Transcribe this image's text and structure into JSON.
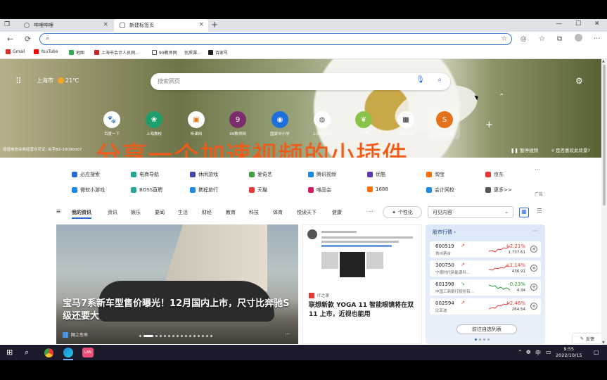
{
  "tabs": [
    {
      "label": "哔哩哔哩",
      "close": "×"
    },
    {
      "label": "新建标签页",
      "close": "×"
    }
  ],
  "tab_new": "+",
  "window_controls": [
    "—",
    "☐",
    "✕"
  ],
  "nav": {
    "back": "←",
    "reload": "⟳"
  },
  "address": {
    "value": "",
    "placeholder": ""
  },
  "bookmarks": [
    {
      "label": "Gmail",
      "color": "#d93025"
    },
    {
      "label": "YouTube",
      "color": "#ff0000"
    },
    {
      "label": "地图",
      "color": "#34a853"
    },
    {
      "label": "上海市会计人员网...",
      "color": "#c62828"
    },
    {
      "label": "99教师网",
      "color": "#555555"
    },
    {
      "label": "优质课...",
      "color": "#444444"
    },
    {
      "label": "百家号",
      "color": "#222222"
    }
  ],
  "hero": {
    "location": "上海市",
    "temperature": "21℃",
    "search_placeholder": "搜索网页",
    "icp": "增值电信业务经营许可证: 合字B2-20090007",
    "pause": "暂停视频",
    "like": "是否喜欢此背景?",
    "overlay_caption": "分享一个加速视频的小插件",
    "quick_links": [
      {
        "label": "百度一下",
        "glyph": "🐾",
        "color": "#2932e1"
      },
      {
        "label": "上海教校",
        "glyph": "❀",
        "color": "#1e9e6a"
      },
      {
        "label": "听课网",
        "glyph": "▣",
        "color": "#e0771b"
      },
      {
        "label": "99教师网",
        "glyph": "9",
        "color": "#7b2d6b"
      },
      {
        "label": "国家中小学",
        "glyph": "◉",
        "color": "#1e6fd9"
      },
      {
        "label": "上海市会计",
        "glyph": "◍",
        "color": "#5a5a5a"
      },
      {
        "label": "https",
        "glyph": "❦",
        "color": "#8bc34a"
      },
      {
        "label": "百度网盘",
        "glyph": "▦",
        "color": "#222222"
      },
      {
        "label": "12门户网",
        "glyph": "S",
        "color": "#e6711b"
      }
    ]
  },
  "links": [
    {
      "label": "必应搜索",
      "color": "#2b6cd1"
    },
    {
      "label": "电商导航",
      "color": "#26a69a"
    },
    {
      "label": "休闲游戏",
      "color": "#3949ab"
    },
    {
      "label": "爱奇艺",
      "color": "#43a047"
    },
    {
      "label": "腾讯视频",
      "color": "#1e88e5"
    },
    {
      "label": "优酷",
      "color": "#5e35b1"
    },
    {
      "label": "淘宝",
      "color": "#ff6f00"
    },
    {
      "label": "京东",
      "color": "#e53935"
    },
    {
      "label": "微软小游戏",
      "color": "#1e88e5"
    },
    {
      "label": "BOSS直聘",
      "color": "#26a69a"
    },
    {
      "label": "携程旅行",
      "color": "#1e88e5"
    },
    {
      "label": "天猫",
      "color": "#e53935"
    },
    {
      "label": "唯品会",
      "color": "#d81b60"
    },
    {
      "label": "1688",
      "color": "#ff6f00"
    },
    {
      "label": "会计网校",
      "color": "#1e88e5"
    },
    {
      "label": "更多>>",
      "color": "#555555"
    }
  ],
  "links_ad": "广告",
  "feed_nav": [
    "我的资讯",
    "资讯",
    "娱乐",
    "要闻",
    "生活",
    "财经",
    "教育",
    "科技",
    "体育",
    "悦读天下",
    "健康"
  ],
  "feed_more": "···",
  "personalize": "个性化",
  "visible_content": "可见内容",
  "main_story": {
    "headline": "宝马7系新车型售价曝光！12月国内上市，尺寸比奔驰S级还要大",
    "source": "网上车市",
    "more": "···"
  },
  "mid_story": {
    "source": "IT之家",
    "headline": "联想新款 YOGA 11 智能眼镜将在双 11 上市，近视也能用"
  },
  "market": {
    "title": "股市行情",
    "more": "···",
    "stocks": [
      {
        "code": "600519",
        "name": "贵州茅台",
        "change": "+2.21%",
        "price": "1,737.61",
        "dir": "up"
      },
      {
        "code": "300750",
        "name": "宁德时代新能源科...",
        "change": "+1.14%",
        "price": "436.91",
        "dir": "up"
      },
      {
        "code": "601398",
        "name": "中国工商银行股份有...",
        "change": "-0.23%",
        "price": "4.34",
        "dir": "dn"
      },
      {
        "code": "002594",
        "name": "比亚迪",
        "change": "+2.46%",
        "price": "264.54",
        "dir": "up"
      }
    ],
    "go_list": "前往自选列表"
  },
  "feedback": "反馈",
  "taskbar": {
    "tray_lang": "中",
    "time": "9:55",
    "date": "2022/10/15",
    "app_label": "LAN"
  }
}
